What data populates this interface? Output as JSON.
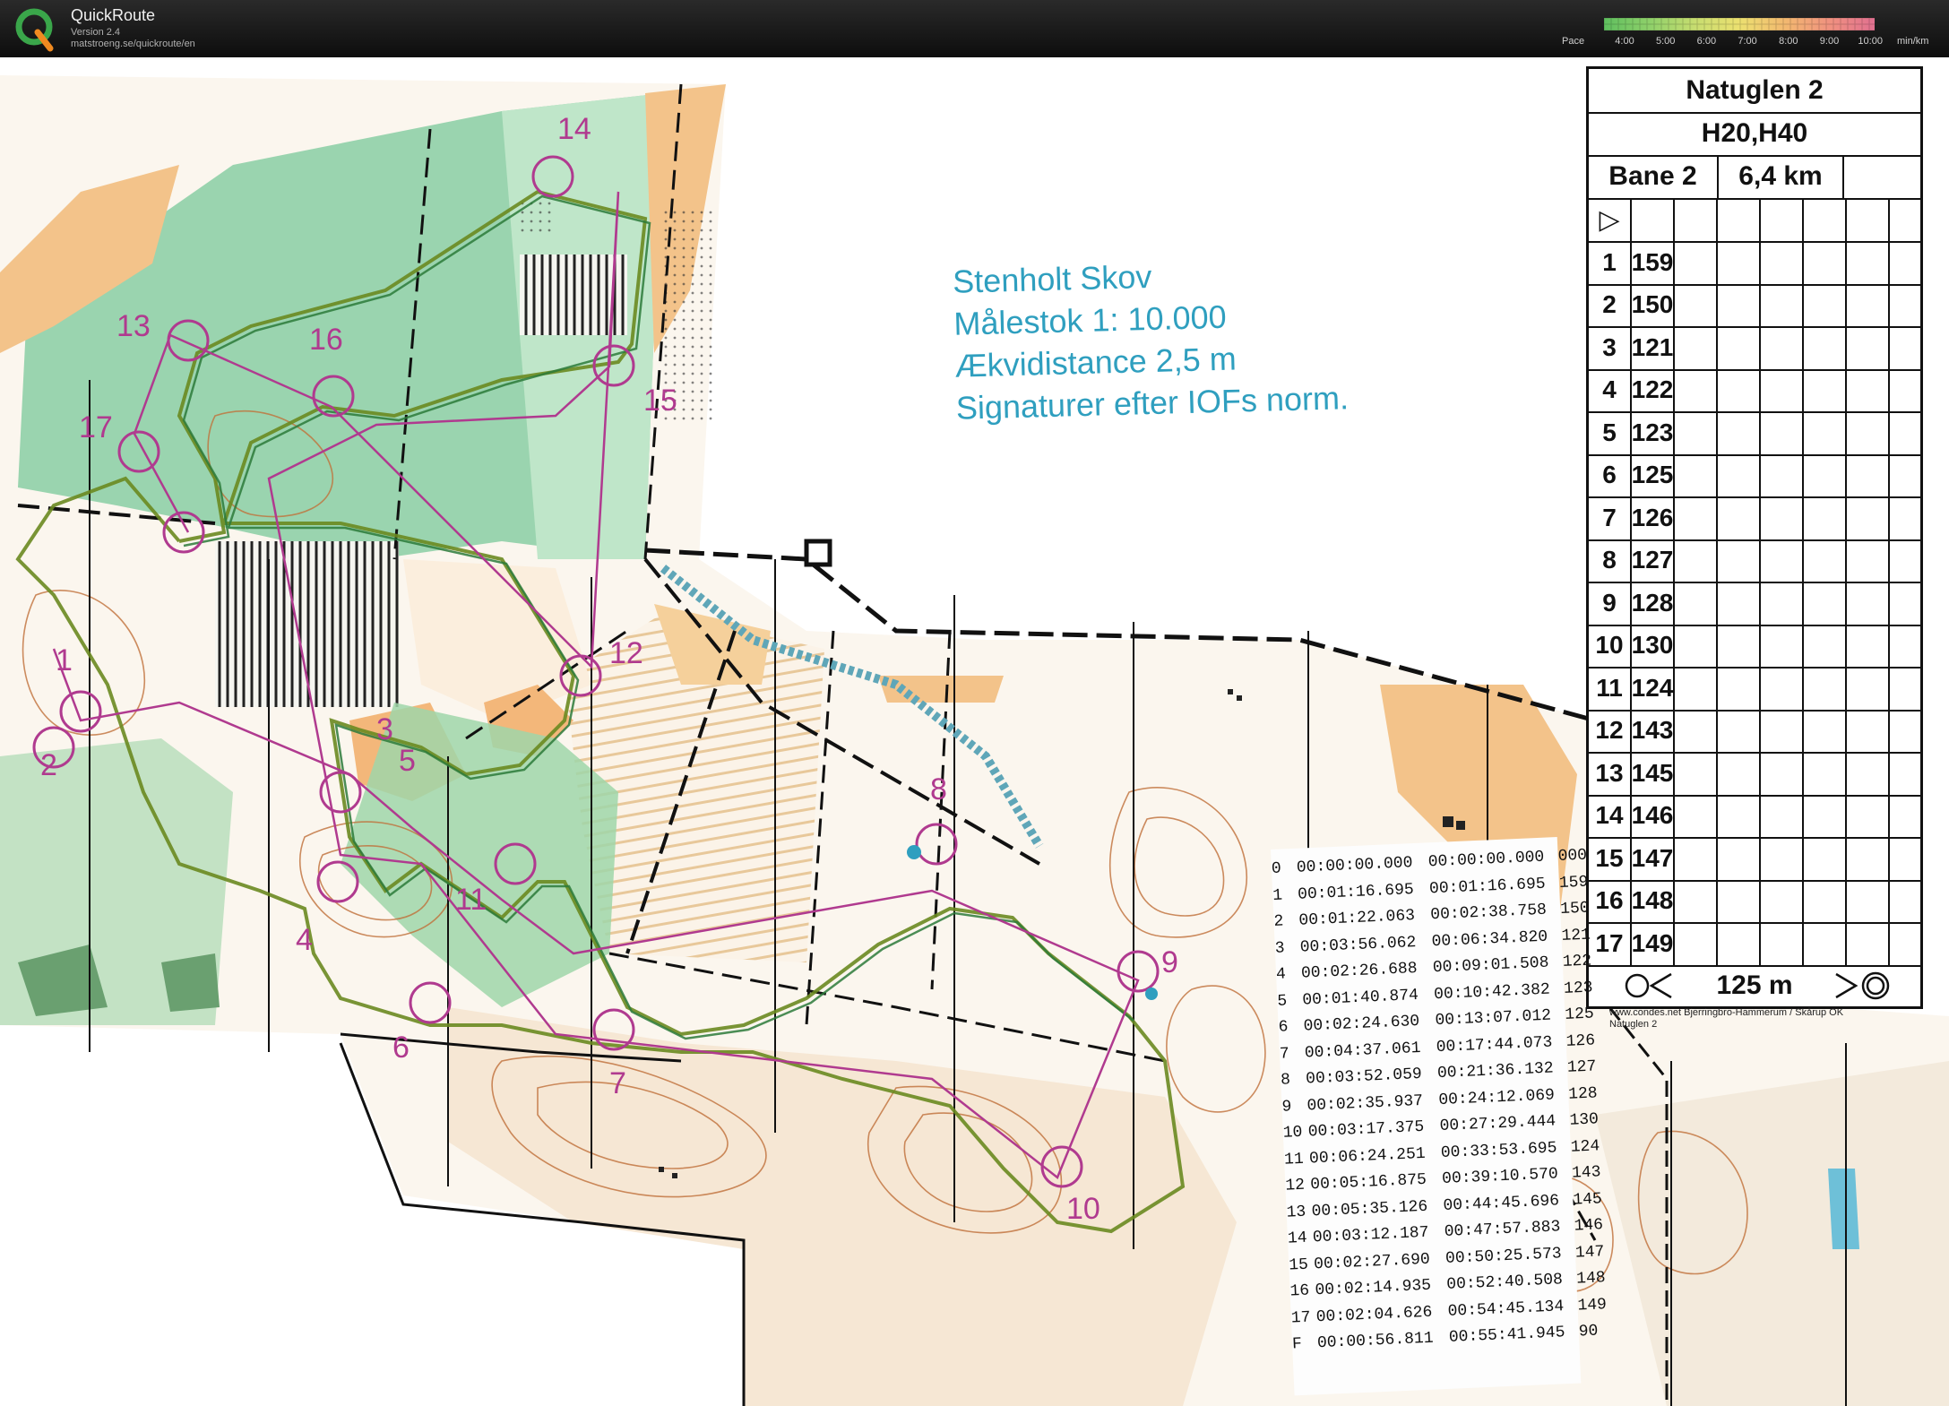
{
  "app": {
    "name": "QuickRoute",
    "version": "Version 2.4",
    "url": "matstroeng.se/quickroute/en"
  },
  "pace_legend": {
    "label": "Pace",
    "ticks": [
      "4:00",
      "5:00",
      "6:00",
      "7:00",
      "8:00",
      "9:00",
      "10:00"
    ],
    "unit": "min/km",
    "colors": [
      "#5fbf5f",
      "#8fd06a",
      "#c8dd70",
      "#ece070",
      "#f2b870",
      "#f09080",
      "#e07090"
    ]
  },
  "map": {
    "title_lines": [
      "Stenholt Skov",
      "Målestok    1: 10.000",
      "Ækvidistance 2,5 m",
      "Signaturer efter IOFs norm."
    ],
    "control_labels": [
      "14",
      "13",
      "16",
      "15",
      "17",
      "12",
      "5",
      "8",
      "9",
      "4",
      "10",
      "2",
      "3",
      "1",
      "11",
      "6",
      "7"
    ],
    "colors": {
      "control": "#b03a8f",
      "route": "#6a8a20",
      "forest_green": "#7cc59a",
      "open_orange": "#f3c38a",
      "contour": "#c0703a",
      "water": "#2f9fbf"
    }
  },
  "description_sheet": {
    "title": "Natuglen 2",
    "classes": "H20,H40",
    "course": "Bane 2",
    "length": "6,4 km",
    "start_symbol": "▷",
    "controls": [
      {
        "num": "1",
        "code": "159"
      },
      {
        "num": "2",
        "code": "150"
      },
      {
        "num": "3",
        "code": "121"
      },
      {
        "num": "4",
        "code": "122"
      },
      {
        "num": "5",
        "code": "123"
      },
      {
        "num": "6",
        "code": "125"
      },
      {
        "num": "7",
        "code": "126"
      },
      {
        "num": "8",
        "code": "127"
      },
      {
        "num": "9",
        "code": "128"
      },
      {
        "num": "10",
        "code": "130"
      },
      {
        "num": "11",
        "code": "124"
      },
      {
        "num": "12",
        "code": "143"
      },
      {
        "num": "13",
        "code": "145"
      },
      {
        "num": "14",
        "code": "146"
      },
      {
        "num": "15",
        "code": "147"
      },
      {
        "num": "16",
        "code": "148"
      },
      {
        "num": "17",
        "code": "149"
      }
    ],
    "finish_distance": "125 m",
    "footer": [
      "www.condes.net Bjerringbro-Hammerum / Skårup OK",
      "Natuglen 2"
    ]
  },
  "splits": [
    {
      "n": "0",
      "leg": "00:00:00.000",
      "total": "00:00:00.000",
      "code": "000"
    },
    {
      "n": "1",
      "leg": "00:01:16.695",
      "total": "00:01:16.695",
      "code": "159"
    },
    {
      "n": "2",
      "leg": "00:01:22.063",
      "total": "00:02:38.758",
      "code": "150"
    },
    {
      "n": "3",
      "leg": "00:03:56.062",
      "total": "00:06:34.820",
      "code": "121"
    },
    {
      "n": "4",
      "leg": "00:02:26.688",
      "total": "00:09:01.508",
      "code": "122"
    },
    {
      "n": "5",
      "leg": "00:01:40.874",
      "total": "00:10:42.382",
      "code": "123"
    },
    {
      "n": "6",
      "leg": "00:02:24.630",
      "total": "00:13:07.012",
      "code": "125"
    },
    {
      "n": "7",
      "leg": "00:04:37.061",
      "total": "00:17:44.073",
      "code": "126"
    },
    {
      "n": "8",
      "leg": "00:03:52.059",
      "total": "00:21:36.132",
      "code": "127"
    },
    {
      "n": "9",
      "leg": "00:02:35.937",
      "total": "00:24:12.069",
      "code": "128"
    },
    {
      "n": "10",
      "leg": "00:03:17.375",
      "total": "00:27:29.444",
      "code": "130"
    },
    {
      "n": "11",
      "leg": "00:06:24.251",
      "total": "00:33:53.695",
      "code": "124"
    },
    {
      "n": "12",
      "leg": "00:05:16.875",
      "total": "00:39:10.570",
      "code": "143"
    },
    {
      "n": "13",
      "leg": "00:05:35.126",
      "total": "00:44:45.696",
      "code": "145"
    },
    {
      "n": "14",
      "leg": "00:03:12.187",
      "total": "00:47:57.883",
      "code": "146"
    },
    {
      "n": "15",
      "leg": "00:02:27.690",
      "total": "00:50:25.573",
      "code": "147"
    },
    {
      "n": "16",
      "leg": "00:02:14.935",
      "total": "00:52:40.508",
      "code": "148"
    },
    {
      "n": "17",
      "leg": "00:02:04.626",
      "total": "00:54:45.134",
      "code": "149"
    },
    {
      "n": "F",
      "leg": "00:00:56.811",
      "total": "00:55:41.945",
      "code": "90"
    }
  ]
}
